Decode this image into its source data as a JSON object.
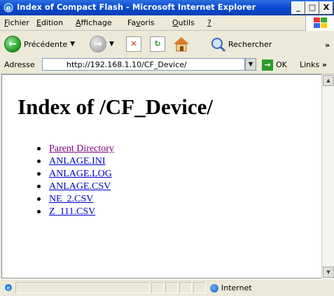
{
  "window": {
    "title": "Index of Compact Flash - Microsoft Internet Explorer",
    "minimize": "_",
    "restore": "□",
    "close": "X"
  },
  "menu": {
    "items": [
      {
        "label": "Fichier",
        "accel": "F",
        "rest": "ichier"
      },
      {
        "label": "Edition",
        "accel": "E",
        "rest": "dition"
      },
      {
        "label": "Affichage",
        "accel": "A",
        "rest": "ffichage"
      },
      {
        "label": "Favoris",
        "accel": "F",
        "pre": "Fa",
        "rest": "oris"
      },
      {
        "label": "Outils",
        "accel": "O",
        "rest": "utils"
      },
      {
        "label": "?",
        "accel": "?",
        "rest": ""
      }
    ]
  },
  "toolbar": {
    "back_label": "Précédente",
    "search_label": "Rechercher",
    "overflow": "»"
  },
  "address": {
    "label": "Adresse",
    "url": "http://192.168.1.10/CF_Device/",
    "go_label": "OK",
    "links_label": "Links",
    "links_overflow": "»"
  },
  "page": {
    "heading": "Index of /CF_Device/",
    "files": [
      {
        "name": "Parent Directory",
        "visited": true
      },
      {
        "name": "ANLAGE.INI",
        "visited": false
      },
      {
        "name": "ANLAGE.LOG",
        "visited": false
      },
      {
        "name": "ANLAGE.CSV",
        "visited": false
      },
      {
        "name": "NE_2.CSV",
        "visited": false
      },
      {
        "name": "Z_111.CSV",
        "visited": false
      }
    ]
  },
  "status": {
    "zone": "Internet"
  },
  "colors": {
    "titlebar": "#0a4bd2",
    "link": "#0000cc",
    "visited_link": "#800080"
  }
}
